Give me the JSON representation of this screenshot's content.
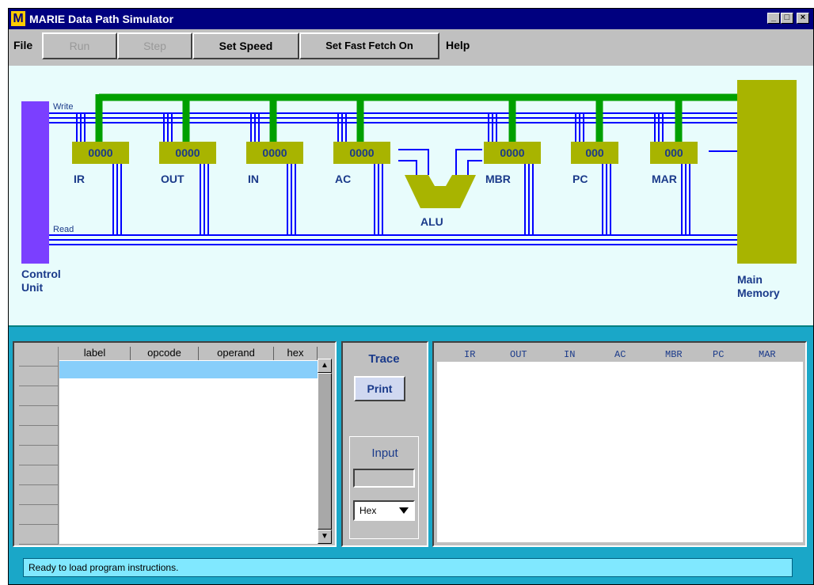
{
  "window": {
    "title": "MARIE Data Path Simulator",
    "logo_letter": "M",
    "controls": {
      "minimize": "_",
      "maximize": "□",
      "close": "×"
    }
  },
  "menubar": {
    "file": "File",
    "run": "Run",
    "step": "Step",
    "set_speed": "Set Speed",
    "set_fast_fetch": "Set Fast Fetch On",
    "help": "Help"
  },
  "datapath": {
    "control_unit": "Control Unit",
    "control_unit_line1": "Control",
    "control_unit_line2": "Unit",
    "main_memory_line1": "Main",
    "main_memory_line2": "Memory",
    "write_label": "Write",
    "read_label": "Read",
    "alu_label": "ALU",
    "registers": [
      {
        "name": "IR",
        "value": "0000"
      },
      {
        "name": "OUT",
        "value": "0000"
      },
      {
        "name": "IN",
        "value": "0000"
      },
      {
        "name": "AC",
        "value": "0000"
      },
      {
        "name": "MBR",
        "value": "0000"
      },
      {
        "name": "PC",
        "value": "000"
      },
      {
        "name": "MAR",
        "value": "000"
      }
    ],
    "colors": {
      "bus": "#0000ff",
      "data_bus": "#00a000",
      "register": "#a8b400",
      "control_unit": "#7b3fff",
      "memory": "#a8b400",
      "label": "#1a3a8a"
    }
  },
  "program": {
    "columns": [
      "label",
      "opcode",
      "operand",
      "hex"
    ],
    "rows": []
  },
  "trace": {
    "title": "Trace",
    "print": "Print",
    "input_label": "Input",
    "input_value": "",
    "format": "Hex"
  },
  "output": {
    "columns": [
      "IR",
      "OUT",
      "IN",
      "AC",
      "MBR",
      "PC",
      "MAR"
    ]
  },
  "status": "Ready to load program instructions."
}
